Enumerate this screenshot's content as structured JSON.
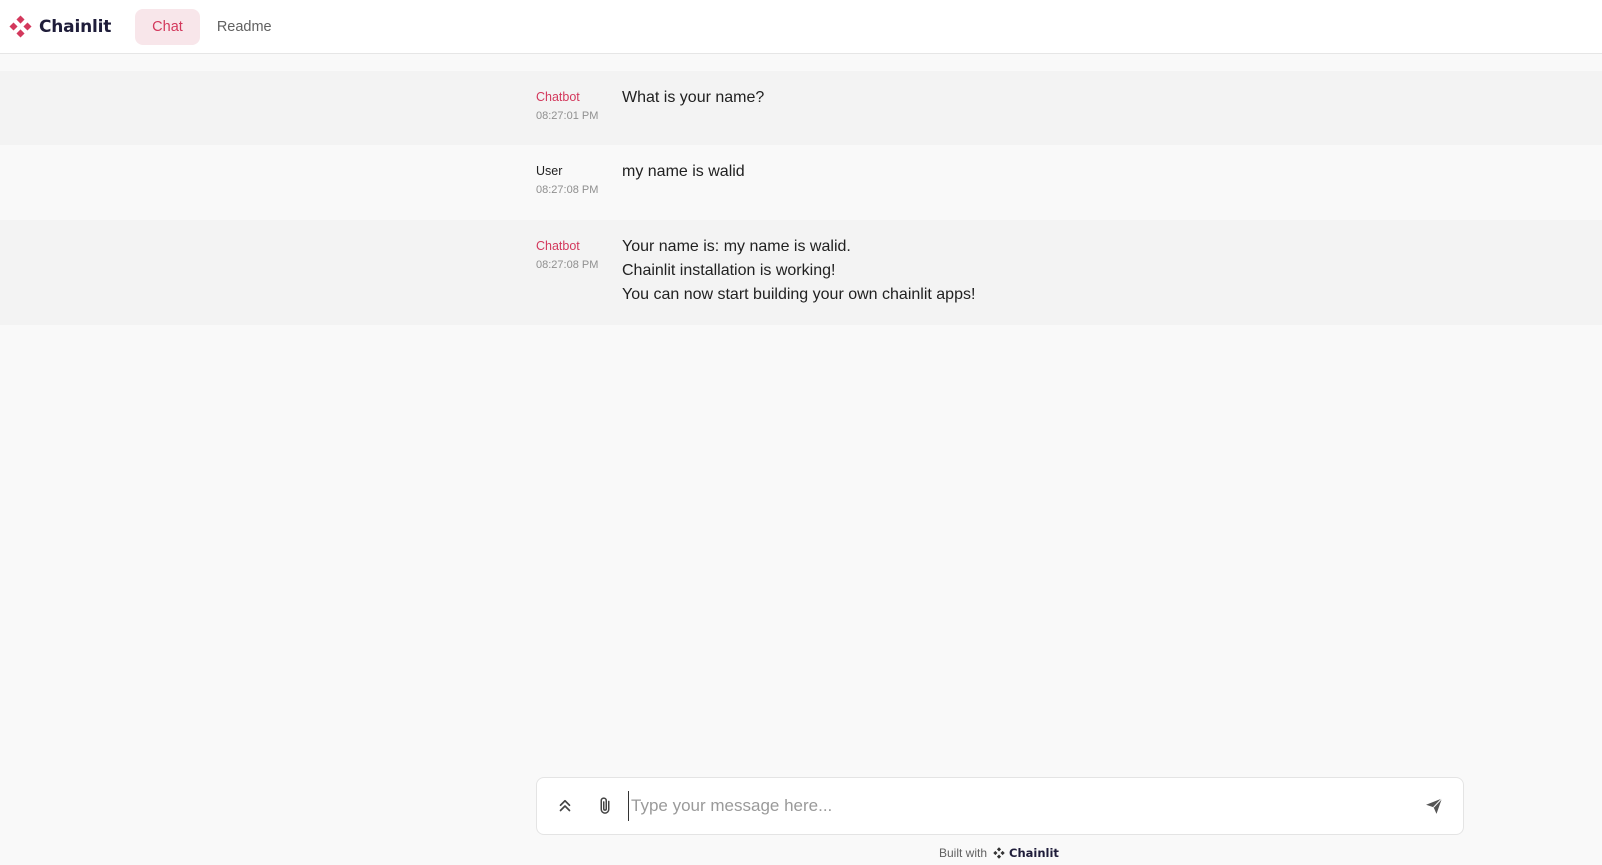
{
  "header": {
    "brand": "Chainlit",
    "tabs": [
      {
        "label": "Chat",
        "active": true
      },
      {
        "label": "Readme",
        "active": false
      }
    ]
  },
  "messages": [
    {
      "author": "Chatbot",
      "role": "bot",
      "time": "08:27:01 PM",
      "lines": [
        "What is your name?"
      ]
    },
    {
      "author": "User",
      "role": "user",
      "time": "08:27:08 PM",
      "lines": [
        "my name is walid"
      ]
    },
    {
      "author": "Chatbot",
      "role": "bot",
      "time": "08:27:08 PM",
      "lines": [
        "Your name is: my name is walid.",
        "Chainlit installation is working!",
        "You can now start building your own chainlit apps!"
      ]
    }
  ],
  "composer": {
    "placeholder": "Type your message here...",
    "value": ""
  },
  "footer": {
    "built_with": "Built with",
    "brand": "Chainlit"
  },
  "colors": {
    "accent": "#d3385c",
    "brand_dark": "#1f1d3a",
    "bot_row_bg": "#f3f3f3",
    "page_bg": "#f9f9f9"
  },
  "icons": [
    "chainlit-logo-icon",
    "chevrons-up-icon",
    "paperclip-icon",
    "send-icon"
  ]
}
